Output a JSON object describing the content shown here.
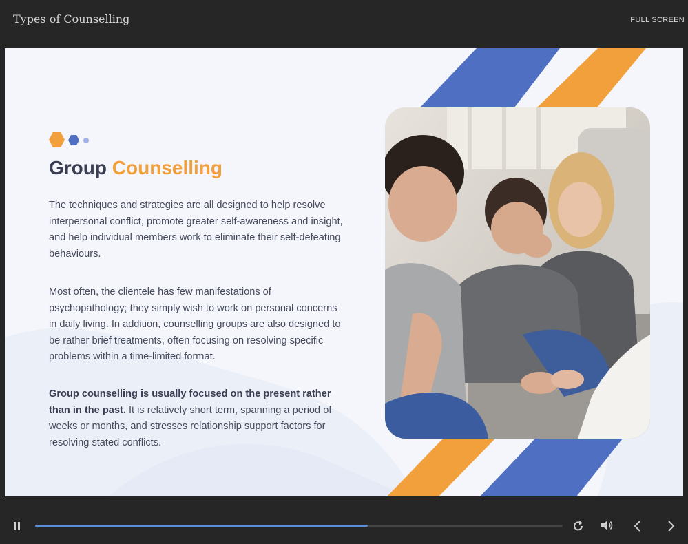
{
  "player": {
    "title": "Types of Counselling",
    "fullscreen_label": "FULL SCREEN",
    "progress_percent": 63
  },
  "slide": {
    "heading_main": "Group",
    "heading_accent": "Counselling",
    "paragraph1": "The techniques and strategies are all designed to help resolve interpersonal conflict, promote greater self-awareness and insight, and help individual members work to eliminate their self-defeating behaviours.",
    "paragraph2": "Most often, the clientele has few manifestations of psychopathology; they simply wish to work on personal concerns in daily living. In addition, counselling groups are also designed to be rather brief treatments, often focusing on resolving specific problems within a time-limited format.",
    "paragraph3_bold": "Group counselling is usually focused on the present rather than in the past.",
    "paragraph3_rest": " It is relatively short term, spanning a period of weeks or months, and stresses relationship support factors for resolving stated conflicts."
  },
  "colors": {
    "accent_orange": "#f2a03c",
    "accent_blue": "#4f6fc3",
    "progress": "#5d8dd6"
  },
  "controls": {
    "pause_icon": "pause-icon",
    "replay_icon": "replay-icon",
    "volume_icon": "volume-icon",
    "prev_icon": "chevron-left-icon",
    "next_icon": "chevron-right-icon"
  }
}
